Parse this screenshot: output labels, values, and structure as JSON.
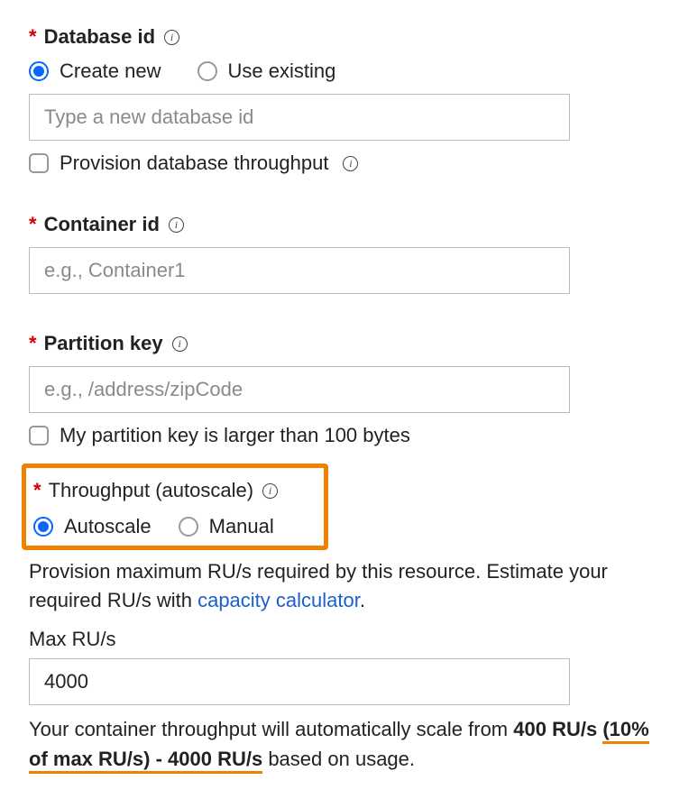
{
  "database": {
    "label": "Database id",
    "create_new_label": "Create new",
    "use_existing_label": "Use existing",
    "selected": "create_new",
    "id_placeholder": "Type a new database id",
    "id_value": "",
    "provision_label": "Provision database throughput",
    "provision_checked": false
  },
  "container": {
    "label": "Container id",
    "placeholder": "e.g., Container1",
    "value": ""
  },
  "partition": {
    "label": "Partition key",
    "placeholder": "e.g., /address/zipCode",
    "value": "",
    "large_key_label": "My partition key is larger than 100 bytes",
    "large_key_checked": false
  },
  "throughput": {
    "label": "Throughput (autoscale)",
    "autoscale_label": "Autoscale",
    "manual_label": "Manual",
    "selected": "autoscale",
    "desc_prefix": "Provision maximum RU/s required by this resource. Estimate your required RU/s with ",
    "desc_link": "capacity calculator",
    "desc_suffix": ".",
    "max_rus_label": "Max RU/s",
    "max_rus_value": "4000",
    "scale_msg_prefix": "Your container throughput will automatically scale from ",
    "scale_range_1": "400 RU/s ",
    "scale_range_2": "(10% of max RU/s) - 4000 RU/s",
    "scale_msg_suffix": " based on usage."
  }
}
